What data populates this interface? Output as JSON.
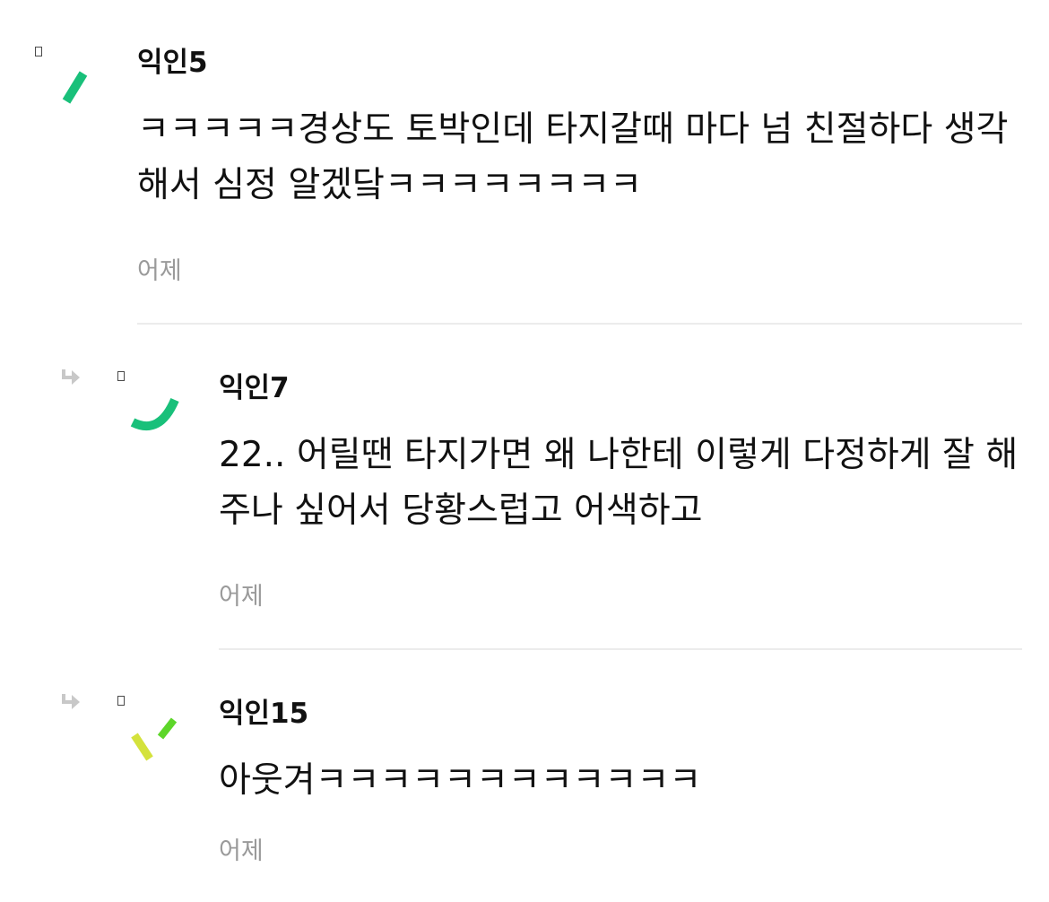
{
  "comments": [
    {
      "author": "익인5",
      "body": "ㅋㅋㅋㅋㅋ경상도 토박인데 타지갈때 마다 넘 친절하다 생각해서 심정 알겠닼ㅋㅋㅋㅋㅋㅋㅋㅋ",
      "time": "어제",
      "is_reply": false,
      "avatar_color": "#19c07a"
    },
    {
      "author": "익인7",
      "body": "22.. 어릴땐 타지가면 왜 나한테 이렇게 다정하게 잘 해주나 싶어서 당황스럽고 어색하고",
      "time": "어제",
      "is_reply": true,
      "avatar_color": "#19c07a"
    },
    {
      "author": "익인15",
      "body": "아웃겨ㅋㅋㅋㅋㅋㅋㅋㅋㅋㅋㅋㅋ",
      "time": "어제",
      "is_reply": true,
      "avatar_colors": [
        "#d4e23c",
        "#5dd62a"
      ]
    }
  ],
  "icons": {
    "reply": "reply-arrow-icon",
    "avatar_placeholder": "broken-image-icon"
  },
  "colors": {
    "timestamp": "#9a9a9a",
    "divider": "#ececec",
    "reply_arrow": "#c8c8c8"
  }
}
